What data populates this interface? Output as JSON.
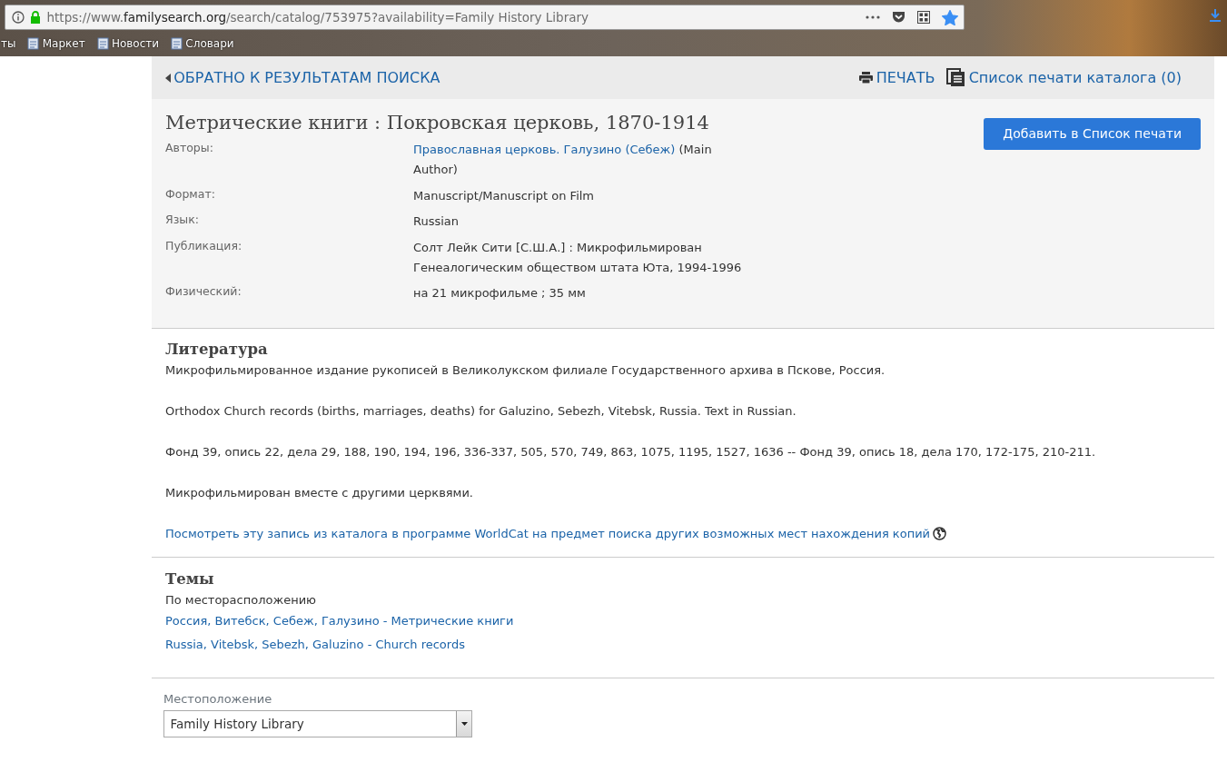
{
  "browser": {
    "url_scheme": "https://www.",
    "url_host": "familysearch.org",
    "url_path": "/search/catalog/753975?availability=Family History Library",
    "bookmarked": true,
    "bookmarks": [
      {
        "kind": "partial",
        "label": "ты"
      },
      {
        "kind": "bookmark",
        "label": "Маркет"
      },
      {
        "kind": "bookmark",
        "label": "Новости"
      },
      {
        "kind": "bookmark",
        "label": "Словари"
      }
    ]
  },
  "toolbar": {
    "back_link": "ОБРАТНО К РЕЗУЛЬТАТАМ ПОИСКА",
    "print_link": "ПЕЧАТЬ",
    "print_list_link": "Список печати каталога (0)"
  },
  "record": {
    "title": "Метрические книги : Покровская церковь, 1870-1914",
    "add_button": "Добавить в Список печати",
    "fields": [
      {
        "label": "Авторы:",
        "link": "Православная церковь. Галузино (Себеж)",
        "value": "(Main Author)"
      },
      {
        "label": "Формат:",
        "value": "Manuscript/Manuscript on Film"
      },
      {
        "label": "Язык:",
        "value": "Russian"
      },
      {
        "label": "Публикация:",
        "value": "Солт Лейк Сити [С.Ш.А.] : Микрофильмирован Генеалогическим обществом штата Юта, 1994-1996"
      },
      {
        "label": "Физический:",
        "value": "на 21 микрофильме ; 35 мм"
      }
    ]
  },
  "notes": {
    "heading": "Литература",
    "paragraphs": [
      "Микрофильмированное издание рукописей в Великолукском филиале Государственного архива в Пскове, Россия.",
      "Orthodox Church records (births, marriages, deaths) for Galuzino, Sebezh, Vitebsk, Russia. Text in Russian.",
      "Фонд 39, опись 22, дела 29, 188, 190, 194, 196, 336-337, 505, 570, 749, 863, 1075, 1195, 1527, 1636 -- Фонд 39, опись 18, дела 170, 172-175, 210-211.",
      "Микрофильмирован вместе с другими церквями."
    ],
    "worldcat_link": "Посмотреть эту запись из каталога в программе WorldCat на предмет поиска других возможных мест нахождения копий"
  },
  "subjects": {
    "heading": "Темы",
    "subheading": "По месторасположению",
    "links": [
      "Россия, Витебск, Себеж, Галузино - Метрические книги",
      "Russia, Vitebsk, Sebezh, Galuzino - Church records"
    ]
  },
  "location": {
    "label": "Местоположение",
    "value": "Family History Library"
  }
}
